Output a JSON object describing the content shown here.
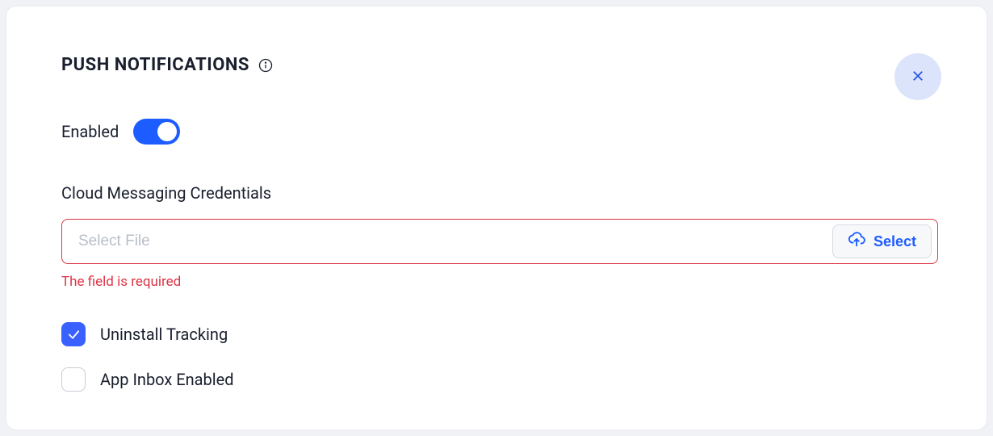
{
  "header": {
    "title": "PUSH NOTIFICATIONS"
  },
  "enabled": {
    "label": "Enabled",
    "value": true
  },
  "credentials": {
    "label": "Cloud Messaging Credentials",
    "placeholder": "Select File",
    "value": "",
    "select_button": "Select",
    "error": "The field is required"
  },
  "options": {
    "uninstall_tracking": {
      "label": "Uninstall Tracking",
      "checked": true
    },
    "app_inbox": {
      "label": "App Inbox Enabled",
      "checked": false
    }
  }
}
